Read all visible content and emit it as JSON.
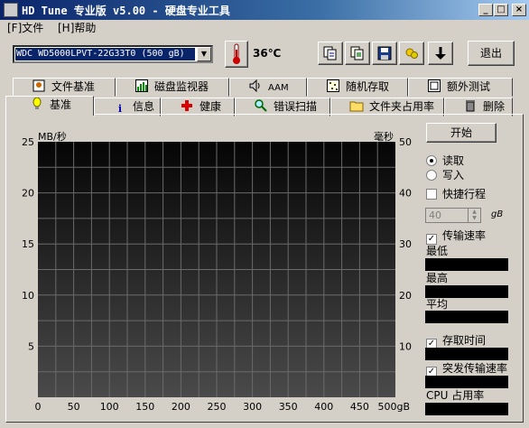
{
  "window": {
    "title": "HD Tune 专业版 v5.00 - 硬盘专业工具",
    "controls": [
      "_",
      "□",
      "×"
    ]
  },
  "menu": [
    {
      "label": "[F]文件"
    },
    {
      "label": "[H]帮助"
    }
  ],
  "toolbar": {
    "drive_selected": "WDC WD5000LPVT-22G33T0 (500 gB)",
    "temperature": "36℃",
    "exit_label": "退出",
    "icons": [
      "copy-info-icon",
      "copy-screen-icon",
      "save-icon",
      "options-icon",
      "download-icon"
    ]
  },
  "tabs_row1": [
    {
      "label": "文件基准",
      "icon": "file-benchmark-icon"
    },
    {
      "label": "磁盘监视器",
      "icon": "disk-monitor-icon"
    },
    {
      "label": "AAM",
      "icon": "speaker-icon"
    },
    {
      "label": "随机存取",
      "icon": "random-access-icon"
    },
    {
      "label": "额外测试",
      "icon": "extra-tests-icon"
    }
  ],
  "tabs_row2": [
    {
      "label": "基准",
      "icon": "benchmark-icon",
      "active": true
    },
    {
      "label": "信息",
      "icon": "info-icon"
    },
    {
      "label": "健康",
      "icon": "health-icon"
    },
    {
      "label": "错误扫描",
      "icon": "error-scan-icon"
    },
    {
      "label": "文件夹占用率",
      "icon": "folder-icon"
    },
    {
      "label": "删除",
      "icon": "trash-icon"
    }
  ],
  "chart_data": {
    "type": "line",
    "left_unit": "MB/秒",
    "right_unit": "毫秒",
    "y_left_ticks": [
      "25",
      "20",
      "15",
      "10",
      "5"
    ],
    "y_right_ticks": [
      "50",
      "40",
      "30",
      "20",
      "10"
    ],
    "x_ticks": [
      "0",
      "50",
      "100",
      "150",
      "200",
      "250",
      "300",
      "350",
      "400",
      "450",
      "500gB"
    ],
    "ylim_left": [
      0,
      25
    ],
    "ylim_right": [
      0,
      50
    ],
    "xlim": [
      0,
      500
    ],
    "grid": true,
    "series": []
  },
  "side_panel": {
    "start_label": "开始",
    "read_label": "读取",
    "write_label": "写入",
    "mode": "read",
    "short_stroke_label": "快捷行程",
    "short_stroke_checked": false,
    "short_stroke_value": "40",
    "short_stroke_unit": "gB",
    "transfer_rate_label": "传输速率",
    "transfer_rate_checked": true,
    "min_label": "最低",
    "max_label": "最高",
    "avg_label": "平均",
    "access_time_label": "存取时间",
    "access_time_checked": true,
    "burst_rate_label": "突发传输速率",
    "burst_rate_checked": true,
    "cpu_label": "CPU 占用率"
  }
}
